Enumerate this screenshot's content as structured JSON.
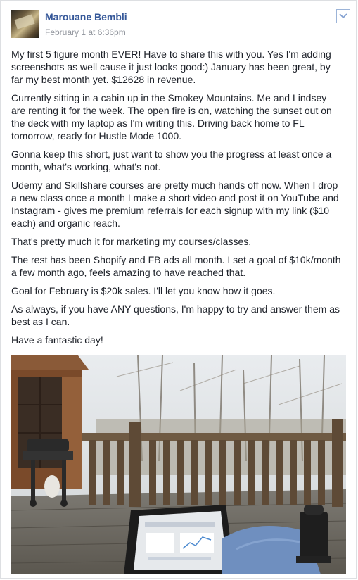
{
  "post": {
    "author": "Marouane Bembli",
    "timestamp": "February 1 at 6:36pm",
    "paragraphs": [
      "My first 5 figure month EVER! Have to share this with you. Yes I'm adding screenshots as well cause it just looks good:) January has been great, by far my best month yet. $12628 in revenue.",
      "Currently sitting in a cabin up in the Smokey Mountains. Me and Lindsey are renting it for the week. The open fire is on, watching the sunset out on the deck with my laptop as I'm writing this. Driving back home to FL tomorrow, ready for Hustle Mode 1000.",
      "Gonna keep this short, just want to show you the progress at least once a month, what's working, what's not.",
      "Udemy and Skillshare courses are pretty much hands off now. When I drop a new class once a month I make a short video and post it on YouTube and Instagram - gives me premium referrals for each signup with my link ($10 each) and organic reach.",
      "That's pretty much it for marketing my courses/classes.",
      "The rest has been Shopify and FB ads all month. I set a goal of $10k/month a few month ago, feels amazing to have reached that.",
      "Goal for February is $20k sales. I'll let you know how it goes.",
      "As always, if you have ANY questions, I'm happy to try and answer them as best as I can.",
      "Have a fantastic day!"
    ]
  },
  "icons": {
    "menu": "chevron-down-icon"
  },
  "colors": {
    "author_link": "#365899",
    "meta_text": "#90949c",
    "body_text": "#1d2129",
    "border": "#dddfe2"
  }
}
